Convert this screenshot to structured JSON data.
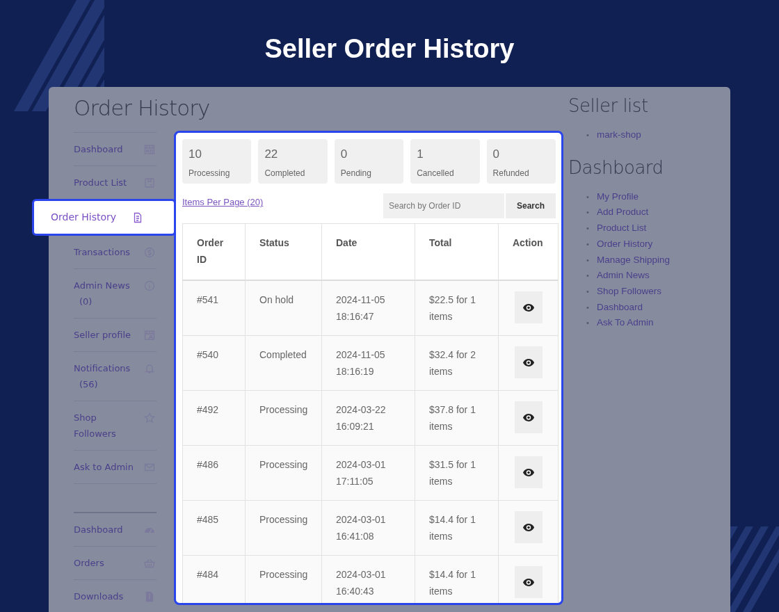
{
  "title": "Seller Order History",
  "page": {
    "heading": "Order History"
  },
  "sidebar": {
    "groups": [
      {
        "items": [
          {
            "label": "Dashboard",
            "selected": false
          },
          {
            "label": "Product List",
            "selected": false
          },
          {
            "label": "Order History",
            "selected": true
          },
          {
            "label": "Transactions",
            "selected": false
          },
          {
            "label": "Admin News",
            "count": "(0)",
            "selected": false
          },
          {
            "label": "Seller profile",
            "selected": false
          },
          {
            "label": "Notifications",
            "count": "(56)",
            "selected": false
          },
          {
            "label": "Shop Followers",
            "selected": false
          },
          {
            "label": "Ask to Admin",
            "selected": false
          }
        ]
      },
      {
        "items": [
          {
            "label": "Dashboard",
            "selected": false
          },
          {
            "label": "Orders",
            "selected": false
          },
          {
            "label": "Downloads",
            "selected": false
          }
        ]
      }
    ]
  },
  "stats": [
    {
      "count": "10",
      "label": "Processing"
    },
    {
      "count": "22",
      "label": "Completed"
    },
    {
      "count": "0",
      "label": "Pending"
    },
    {
      "count": "1",
      "label": "Cancelled"
    },
    {
      "count": "0",
      "label": "Refunded"
    }
  ],
  "items_per_page_link": "Items Per Page (20)",
  "search": {
    "placeholder": "Search by Order ID",
    "button": "Search"
  },
  "table": {
    "columns": [
      "Order ID",
      "Status",
      "Date",
      "Total",
      "Action"
    ],
    "rows": [
      {
        "order": "#541",
        "status": "On hold",
        "date": "2024-11-05 18:16:47",
        "total": "$22.5 for 1 items"
      },
      {
        "order": "#540",
        "status": "Completed",
        "date": "2024-11-05 18:16:19",
        "total": "$32.4 for 2 items"
      },
      {
        "order": "#492",
        "status": "Processing",
        "date": "2024-03-22 16:09:21",
        "total": "$37.8 for 1 items"
      },
      {
        "order": "#486",
        "status": "Processing",
        "date": "2024-03-01 17:11:05",
        "total": "$31.5 for 1 items"
      },
      {
        "order": "#485",
        "status": "Processing",
        "date": "2024-03-01 16:41:08",
        "total": "$14.4 for 1 items"
      },
      {
        "order": "#484",
        "status": "Processing",
        "date": "2024-03-01 16:40:43",
        "total": "$14.4 for 1 items"
      }
    ]
  },
  "right_sidebar": {
    "sections": [
      {
        "heading": "Seller list",
        "links": [
          {
            "marker": "•",
            "label": "mark-shop"
          }
        ]
      },
      {
        "heading": "Dashboard",
        "links": [
          {
            "marker": "•",
            "label": "My Profile"
          },
          {
            "marker": "•",
            "label": "Add Product"
          },
          {
            "marker": "•",
            "label": "Product List"
          },
          {
            "marker": "•",
            "label": "Order History"
          },
          {
            "marker": "•",
            "label": "Manage Shipping"
          },
          {
            "marker": "•",
            "label": "Admin News"
          },
          {
            "marker": "•",
            "label": "Shop Followers"
          },
          {
            "marker": "•",
            "label": "Dashboard"
          },
          {
            "marker": "•",
            "label": "Ask To Admin"
          }
        ]
      }
    ]
  }
}
